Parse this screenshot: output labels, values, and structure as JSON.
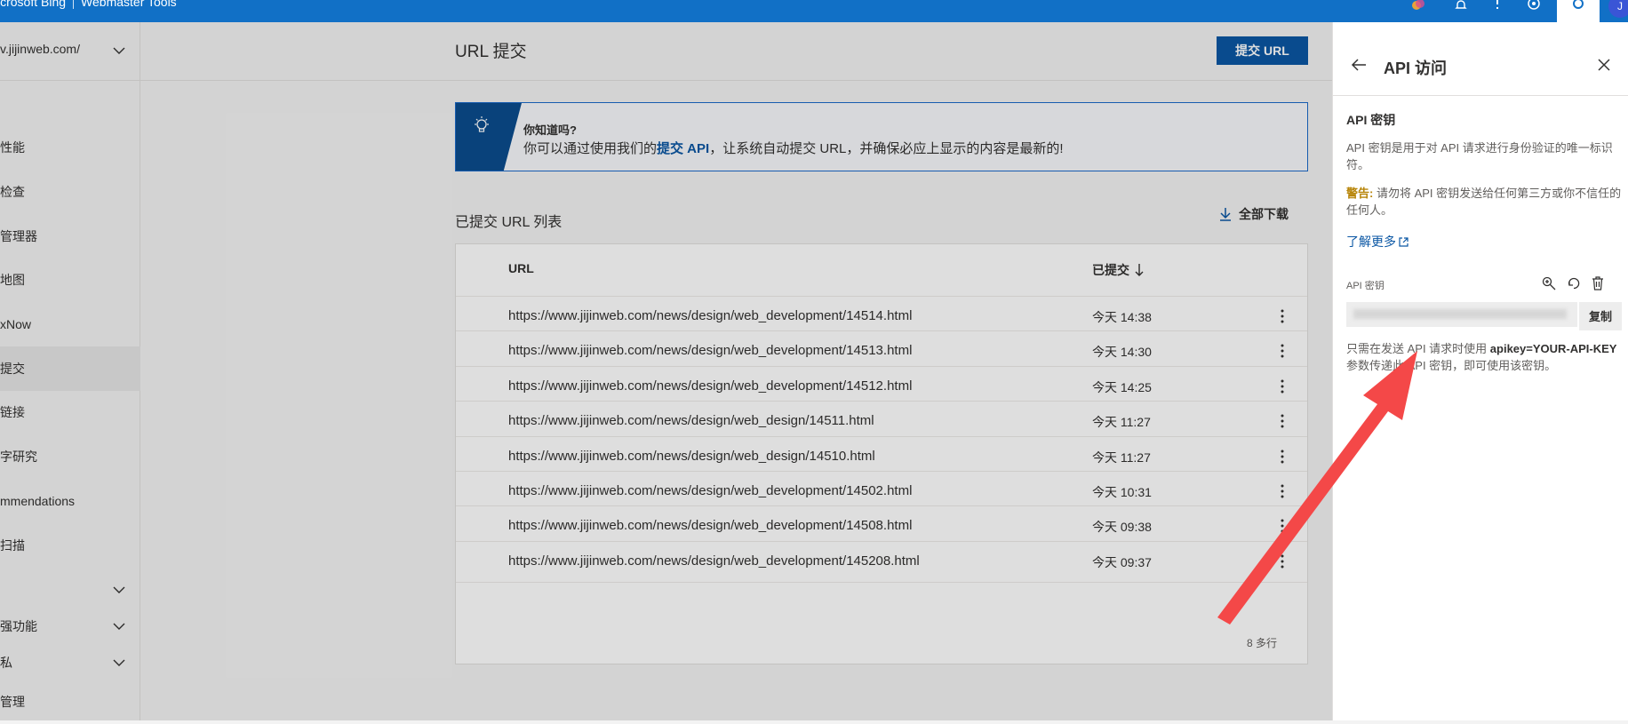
{
  "topbar": {
    "brand_left": "icrosoft Bing",
    "brand_right": "Webmaster Tools",
    "avatar_initial": "J"
  },
  "sidebar": {
    "site_url": "v.jijinweb.com/",
    "items": [
      {
        "label": "性能"
      },
      {
        "label": "检查"
      },
      {
        "label": "管理器"
      },
      {
        "label": "地图"
      },
      {
        "label": "xNow"
      },
      {
        "label": "提交"
      },
      {
        "label": "链接"
      },
      {
        "label": "字研究"
      },
      {
        "label": "mmendations"
      },
      {
        "label": "扫描"
      },
      {
        "label": ""
      },
      {
        "label": "强功能"
      },
      {
        "label": "私"
      },
      {
        "label": "管理"
      }
    ]
  },
  "main": {
    "title": "URL 提交",
    "submit_button": "提交 URL",
    "tip": {
      "title": "你知道吗?",
      "text_before": "你可以通过使用我们的",
      "link": "提交 API",
      "text_after": "，让系统自动提交 URL，并确保必应上显示的内容是最新的!"
    },
    "list_title": "已提交 URL 列表",
    "download_label": "全部下载",
    "table": {
      "columns": [
        "URL",
        "已提交"
      ],
      "rows": [
        {
          "url": "https://www.jijinweb.com/news/design/web_development/14514.html",
          "time": "今天 14:38"
        },
        {
          "url": "https://www.jijinweb.com/news/design/web_development/14513.html",
          "time": "今天 14:30"
        },
        {
          "url": "https://www.jijinweb.com/news/design/web_development/14512.html",
          "time": "今天 14:25"
        },
        {
          "url": "https://www.jijinweb.com/news/design/web_design/14511.html",
          "time": "今天 11:27"
        },
        {
          "url": "https://www.jijinweb.com/news/design/web_design/14510.html",
          "time": "今天 11:27"
        },
        {
          "url": "https://www.jijinweb.com/news/design/web_development/14502.html",
          "time": "今天 10:31"
        },
        {
          "url": "https://www.jijinweb.com/news/design/web_development/14508.html",
          "time": "今天 09:38"
        },
        {
          "url": "https://www.jijinweb.com/news/design/web_development/145208.html",
          "time": "今天 09:37"
        }
      ],
      "row_count": "8 多行"
    }
  },
  "panel": {
    "title": "API 访问",
    "heading": "API 密钥",
    "description": "API 密钥是用于对 API 请求进行身份验证的唯一标识符。",
    "warning_label": "警告:",
    "warning_text": " 请勿将 API 密钥发送给任何第三方或你不信任的任何人。",
    "learn_more": "了解更多",
    "key_label": "API 密钥",
    "copy_label": "复制",
    "usage_before": "只需在发送 API 请求时使用 ",
    "usage_param": "apikey=YOUR-API-KEY",
    "usage_after": " 参数传递此 API 密钥，即可使用该密钥。"
  },
  "colors": {
    "topbar": "#1170c6",
    "primary_button": "#0b57a4",
    "tip_band": "#0b4c8e",
    "annotation_arrow": "#f44848"
  },
  "icons": [
    "settings-icon",
    "help-icon",
    "bell-icon",
    "chevron-down-icon",
    "lightbulb-icon",
    "download-icon",
    "sort-down-icon",
    "more-vertical-icon",
    "back-arrow-icon",
    "close-icon",
    "zoom-icon",
    "regenerate-icon",
    "delete-icon",
    "external-link-icon"
  ]
}
